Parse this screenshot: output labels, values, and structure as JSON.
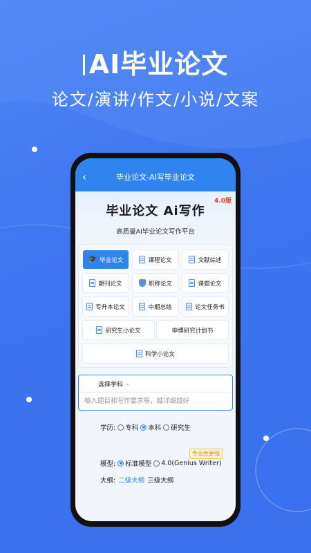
{
  "promo": {
    "title": "AI毕业论文",
    "subtitle": "论文/演讲/作文/小说/文案"
  },
  "app_bar": {
    "title": "毕业论文-AI写毕业论文"
  },
  "hero": {
    "title": "毕业论文 Ai写作",
    "version": "4.0版",
    "subtitle": "高质量AI毕业论文写作平台"
  },
  "paper_types": {
    "row1": [
      "毕业论文",
      "课程论文",
      "文献综述"
    ],
    "row2": [
      "期刊论文",
      "职称论文",
      "课题论文"
    ],
    "row3": [
      "专升本论文",
      "中期总结",
      "论文任务书"
    ],
    "row4": [
      "研究生小论文",
      "申博研究计划书"
    ],
    "row5": [
      "科学小论文"
    ]
  },
  "input": {
    "subject_label": "选择学科",
    "topic_placeholder": "输入题目和写作要求等，越详细越好"
  },
  "degree": {
    "label": "学历:",
    "options": [
      "专科",
      "本科",
      "研究生"
    ],
    "selected": "本科"
  },
  "model": {
    "badge": "专业性更强",
    "label": "模型:",
    "options": [
      "标准模型",
      "4.0(Genius Writer)"
    ],
    "selected": "标准模型"
  },
  "outline": {
    "label": "大纲:",
    "options": [
      "二级大纲",
      "三级大纲"
    ],
    "selected": "二级大纲"
  },
  "colors": {
    "background": "#3d74ef",
    "accent": "#2f84ef",
    "version_badge": "#e2402f",
    "pro_badge": "#d89010"
  }
}
